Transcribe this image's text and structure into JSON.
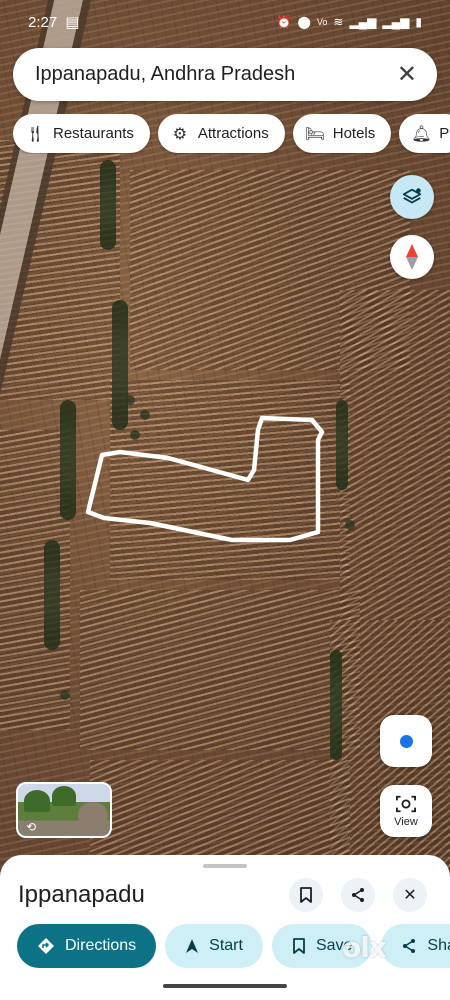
{
  "status_bar": {
    "time": "2:27",
    "indicators": [
      "alarm-icon",
      "location-icon",
      "volte-icon",
      "wifi-icon",
      "signal-icon",
      "signal-icon",
      "battery-icon"
    ]
  },
  "search": {
    "query": "Ippanapadu, Andhra Pradesh",
    "clear_icon": "close-icon"
  },
  "chips": [
    {
      "label": "Restaurants",
      "icon": "fork-knife-icon"
    },
    {
      "label": "Attractions",
      "icon": "attraction-icon"
    },
    {
      "label": "Hotels",
      "icon": "bed-icon"
    },
    {
      "label": "P",
      "icon": "bell-icon"
    }
  ],
  "map_controls": {
    "layers_icon": "layers-icon",
    "compass_icon": "compass-icon",
    "location_icon": "my-location-icon",
    "view_label": "View"
  },
  "place": {
    "title": "Ippanapadu",
    "save_icon": "bookmark-icon",
    "share_icon": "share-icon",
    "close_icon": "close-icon"
  },
  "actions": [
    {
      "label": "Directions",
      "icon": "directions-icon"
    },
    {
      "label": "Start",
      "icon": "navigation-arrow-icon"
    },
    {
      "label": "Save",
      "icon": "bookmark-icon"
    },
    {
      "label": "Share",
      "icon": "share-icon"
    }
  ],
  "watermark": "olx",
  "colors": {
    "primary_action": "#0b7385",
    "secondary_action": "#cdeff5",
    "layers_button": "#c5e8f4",
    "location_dot": "#1a73e8"
  }
}
